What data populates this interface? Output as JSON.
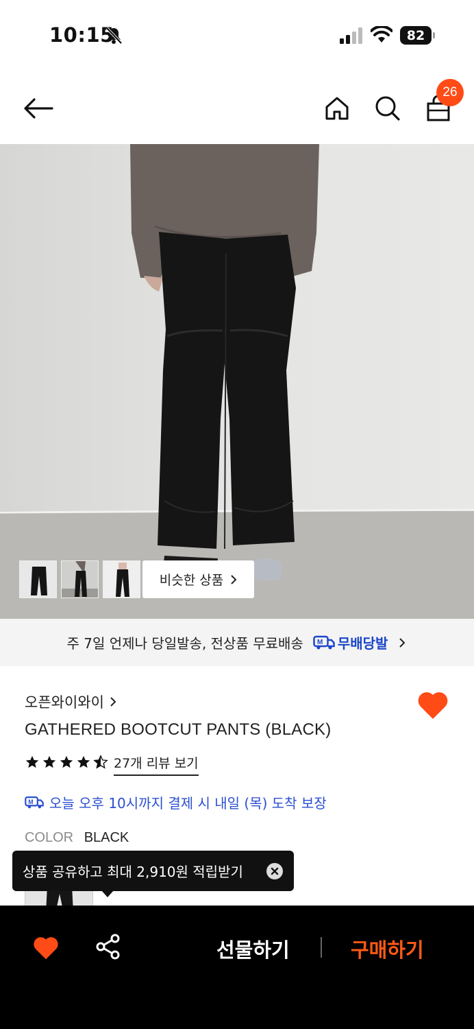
{
  "status_bar": {
    "time": "10:15",
    "battery": "82",
    "icons": [
      "bell-slash-icon",
      "signal-icon",
      "wifi-icon",
      "battery-icon"
    ]
  },
  "nav": {
    "cart_badge": "26",
    "icons": [
      "back-arrow-icon",
      "home-icon",
      "search-icon",
      "shopping-bag-icon"
    ]
  },
  "gallery": {
    "similar_label": "비슷한 상품",
    "thumbnail_count": 3
  },
  "shipping": {
    "text": "주 7일 언제나 당일발송, 전상품 무료배송",
    "brand": "무배당발"
  },
  "product": {
    "store": "오픈와이와이",
    "name": "GATHERED BOOTCUT PANTS (BLACK)",
    "rating": 4.5,
    "review_link": "27개 리뷰 보기",
    "arrival_notice": "오늘 오후 10시까지 결제 시 내일 (목) 도착 보장",
    "color_label": "COLOR",
    "color_value": "BLACK",
    "liked": true
  },
  "tooltip": {
    "text": "상품 공유하고 최대 2,910원 적립받기"
  },
  "bottom_bar": {
    "gift_label": "선물하기",
    "buy_label": "구매하기"
  },
  "colors": {
    "accent": "#ff4b16",
    "link_blue": "#2a4fd1",
    "brand_blue": "#1b47c9"
  }
}
